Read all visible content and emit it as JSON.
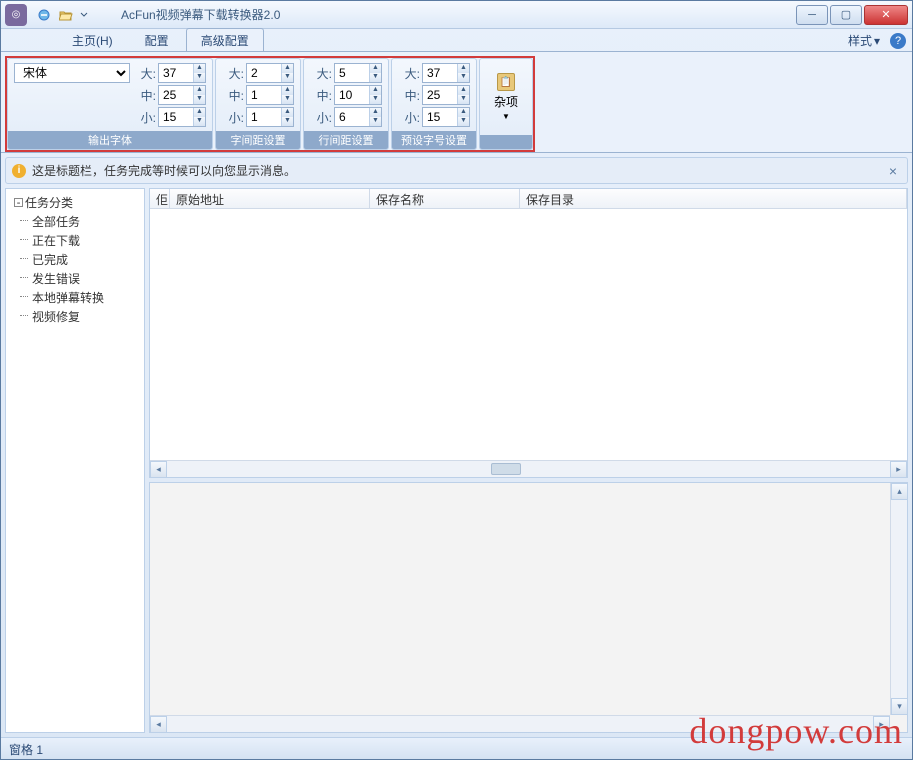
{
  "window": {
    "title": "AcFun视频弹幕下载转换器2.0"
  },
  "tabs": {
    "home": "主页(H)",
    "config": "配置",
    "advanced": "高级配置",
    "style": "样式"
  },
  "ribbon": {
    "font_group_label": "输出字体",
    "char_spacing_label": "字间距设置",
    "line_spacing_label": "行间距设置",
    "preset_size_label": "预设字号设置",
    "misc_label": "杂项",
    "font_value": "宋体",
    "size_large_label": "大:",
    "size_mid_label": "中:",
    "size_small_label": "小:",
    "font": {
      "large": "37",
      "mid": "25",
      "small": "15"
    },
    "charsp": {
      "large": "2",
      "mid": "1",
      "small": "1"
    },
    "linesp": {
      "large": "5",
      "mid": "10",
      "small": "6"
    },
    "preset": {
      "large": "37",
      "mid": "25",
      "small": "15"
    }
  },
  "infobar": {
    "text": "这是标题栏，任务完成等时候可以向您显示消息。"
  },
  "tree": {
    "root": "任务分类",
    "items": [
      "全部任务",
      "正在下载",
      "已完成",
      "发生错误",
      "本地弹幕转换",
      "视频修复"
    ]
  },
  "columns": {
    "c0": "佢",
    "c1": "原始地址",
    "c2": "保存名称",
    "c3": "保存目录"
  },
  "statusbar": {
    "text": "窗格 1"
  },
  "watermark": "dongpow.com"
}
